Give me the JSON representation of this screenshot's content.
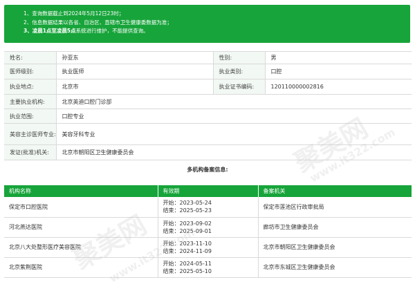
{
  "notice": {
    "line1": "1、查询数据截止到2024年5月12日23时；",
    "line2": "2、信息数据结果以各省、自治区、直辖市卫生健康委数据为准；",
    "line3_bold": "3、凌晨1点至凌晨5点",
    "line3_rest": "系统进行维护，不能提供查询。"
  },
  "doctor": {
    "name_label": "姓名:",
    "name": "孙亚东",
    "gender_label": "性别:",
    "gender": "男",
    "level_label": "医师级别:",
    "level": "执业医师",
    "category_label": "执业类别:",
    "category": "口腔",
    "location_label": "执业地点:",
    "location": "北京市",
    "cert_label": "执业证书编码:",
    "cert": "120110000002816",
    "org_label": "主要执业机构:",
    "org": "北京英迪口腔门诊部",
    "scope_label": "执业范围:",
    "scope": "口腔专业",
    "cosmetic_label": "美容主诊医师专业:",
    "cosmetic": "美容牙科专业",
    "issuer_label": "发证(批准)机关:",
    "issuer": "北京市朝阳区卫生健康委员会"
  },
  "orgs_title": "多机构备案信息:",
  "orgs_table": {
    "headers": [
      "机构名称",
      "有效期",
      "备案机关"
    ],
    "rows": [
      {
        "name": "保定市口腔医院",
        "start": "开始：2023-05-24",
        "end": "结束：2025-05-23",
        "authority": "保定市莲池区行政审批局"
      },
      {
        "name": "河北燕达医院",
        "start": "开始：2023-09-02",
        "end": "结束：2025-09-01",
        "authority": "廊坊市卫生健康委员会"
      },
      {
        "name": "北京八大处整形医疗美容医院",
        "start": "开始：2023-11-10",
        "end": "结束：2024-11-09",
        "authority": "北京市朝阳区卫生健康委员会"
      },
      {
        "name": "北京紫荆医院",
        "start": "开始：2024-05-11",
        "end": "结束：2025-05-10",
        "authority": "北京市东城区卫生健康委员会"
      }
    ]
  },
  "watermark": {
    "brand": "聚美网",
    "url": "www.it322.com"
  }
}
